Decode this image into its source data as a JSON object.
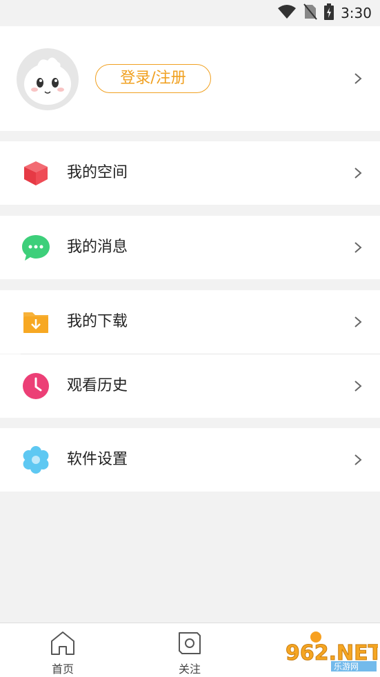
{
  "status_bar": {
    "time": "3:30"
  },
  "profile": {
    "login_label": "登录/注册"
  },
  "menu": [
    {
      "label": "我的空间",
      "icon": "cube-icon",
      "color": "#f0454f"
    },
    {
      "label": "我的消息",
      "icon": "chat-bubble-icon",
      "color": "#3dcf7a"
    },
    {
      "label": "我的下载",
      "icon": "download-folder-icon",
      "color": "#f7a823"
    },
    {
      "label": "观看历史",
      "icon": "clock-icon",
      "color": "#ec3f76"
    },
    {
      "label": "软件设置",
      "icon": "flower-gear-icon",
      "color": "#5ec8f2"
    }
  ],
  "tabbar": {
    "tabs": [
      {
        "label": "首页",
        "icon": "home-icon"
      },
      {
        "label": "关注",
        "icon": "follow-icon"
      }
    ]
  },
  "watermark": {
    "text": "962.NET",
    "subtext": "乐游网"
  }
}
